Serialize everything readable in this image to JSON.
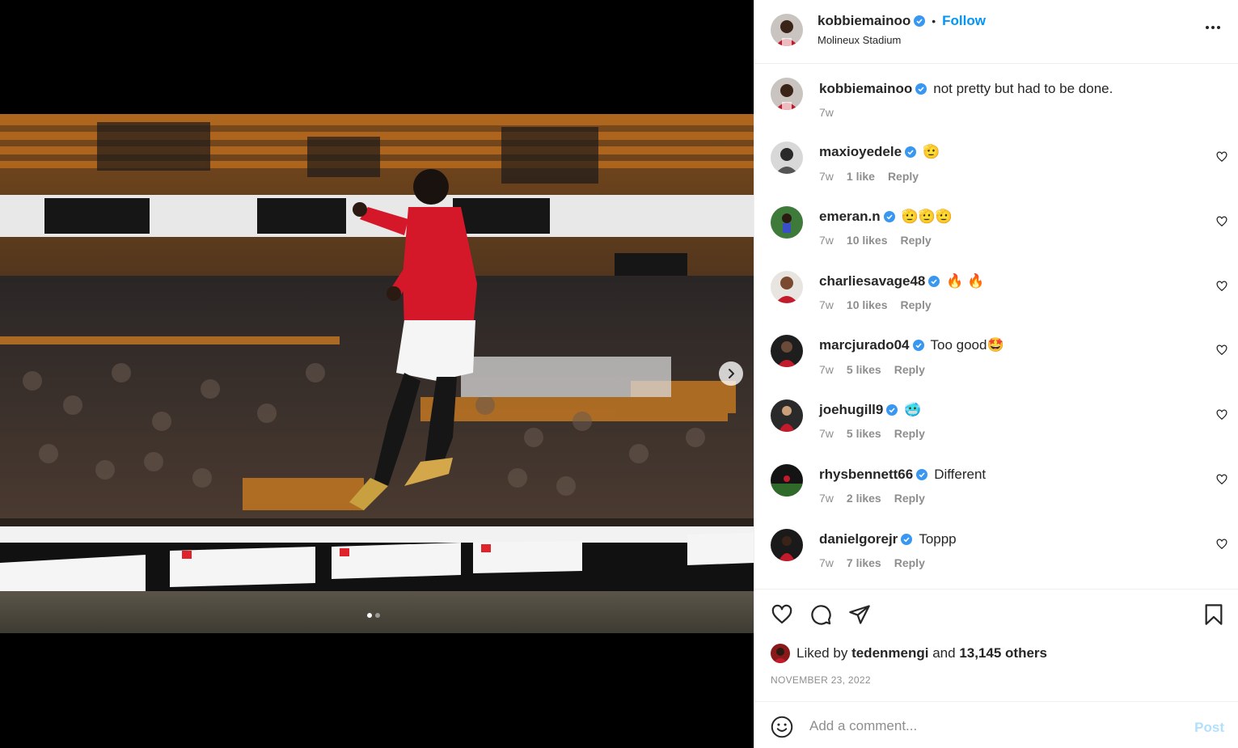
{
  "post": {
    "username": "kobbiemainoo",
    "follow_label": "Follow",
    "separator": "•",
    "location": "Molineux Stadium",
    "caption": "not pretty but had to be done.",
    "caption_time": "7w",
    "carousel": {
      "current": 1,
      "total": 2
    }
  },
  "comments": [
    {
      "username": "maxioyedele",
      "text": "🫡",
      "time": "7w",
      "likes": "1 like",
      "reply": "Reply"
    },
    {
      "username": "emeran.n",
      "text": "🫡🫡🫡",
      "time": "7w",
      "likes": "10 likes",
      "reply": "Reply"
    },
    {
      "username": "charliesavage48",
      "text": "🔥 🔥",
      "time": "7w",
      "likes": "10 likes",
      "reply": "Reply"
    },
    {
      "username": "marcjurado04",
      "text": "Too good🤩",
      "time": "7w",
      "likes": "5 likes",
      "reply": "Reply"
    },
    {
      "username": "joehugill9",
      "text": "🥶",
      "time": "7w",
      "likes": "5 likes",
      "reply": "Reply"
    },
    {
      "username": "rhysbennett66",
      "text": "Different",
      "time": "7w",
      "likes": "2 likes",
      "reply": "Reply"
    },
    {
      "username": "danielgorejr",
      "text": "Toppp",
      "time": "7w",
      "likes": "7 likes",
      "reply": "Reply"
    }
  ],
  "likes": {
    "prefix": "Liked by",
    "user": "tedenmengi",
    "middle": "and",
    "others": "13,145 others"
  },
  "date": "NOVEMBER 23, 2022",
  "add_comment": {
    "placeholder": "Add a comment...",
    "post_label": "Post"
  },
  "icons": {
    "more": "more-options-icon",
    "like": "heart-icon",
    "comment": "comment-icon",
    "share": "send-icon",
    "save": "bookmark-icon",
    "emoji": "emoji-icon",
    "next": "chevron-right-icon",
    "verified": "verified-badge-icon"
  },
  "colors": {
    "accent": "#0095f6",
    "verified": "#3897f0",
    "post_disabled": "#b2dffc",
    "muted": "#8e8e8e"
  }
}
